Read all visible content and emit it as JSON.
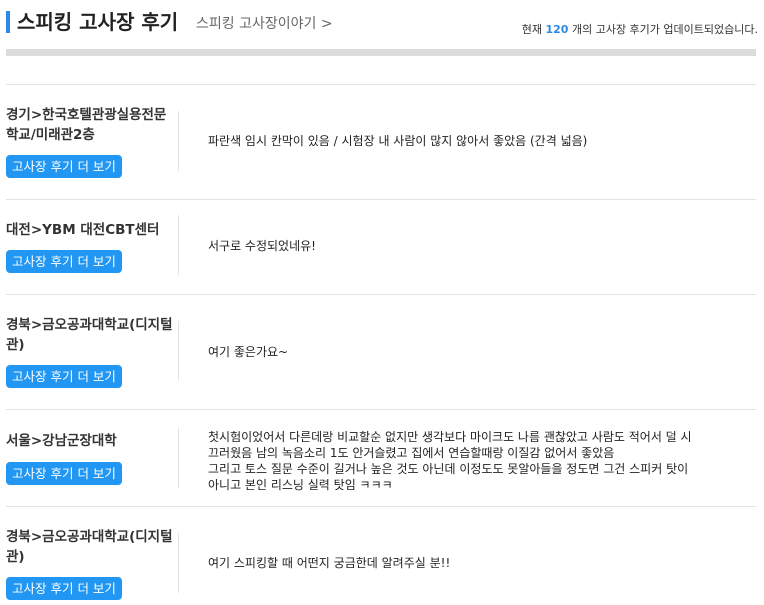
{
  "header": {
    "title": "스피킹 고사장 후기",
    "sub_link": "스피킹 고사장이야기 >",
    "info_prefix": "현재",
    "info_count": "120",
    "info_suffix": "개의 고사장 후기가 업데이트되었습니다."
  },
  "reviews": [
    {
      "location": "경기>한국호텔관광실용전문학교/미래관2층",
      "button_label": "고사장 후기 더 보기",
      "text": [
        "파란색 임시 칸막이 있음 / 시험장 내 사람이 많지 않아서 좋았음 (간격 넓음)"
      ]
    },
    {
      "location": "대전>YBM 대전CBT센터",
      "button_label": "고사장 후기 더 보기",
      "text": [
        "서구로 수정되었네유!"
      ]
    },
    {
      "location": "경북>금오공과대학교(디지털관)",
      "button_label": "고사장 후기 더 보기",
      "text": [
        "여기 좋은가요~"
      ]
    },
    {
      "location": "서울>강남군장대학",
      "button_label": "고사장 후기 더 보기",
      "text": [
        "첫시험이었어서 다른데랑 비교할순 없지만 생각보다 마이크도 나름 괜찮았고 사람도 적어서 덜 시",
        "끄러웠음 남의 녹음소리 1도 안거슬렸고 집에서 연습할때랑 이질감 없어서 좋았음",
        "그리고 토스 질문 수준이 길거나 높은 것도 아닌데 이정도도 못알아들을 정도면 그건 스피커 탓이",
        "아니고 본인 리스닝 실력 탓임 ㅋㅋㅋ"
      ]
    },
    {
      "location": "경북>금오공과대학교(디지털관)",
      "button_label": "고사장 후기 더 보기",
      "text": [
        "여기 스피킹할 때 어떤지 궁금한데 알려주실 분!!"
      ]
    }
  ]
}
